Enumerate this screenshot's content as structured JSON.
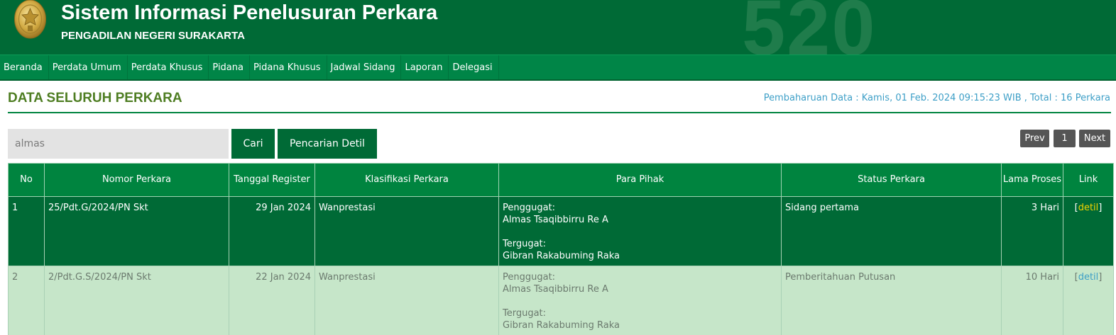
{
  "header": {
    "title": "Sistem Informasi Penelusuran Perkara",
    "subtitle": "PENGADILAN NEGERI SURAKARTA",
    "watermark": "520",
    "logo_icon": "court-emblem-icon"
  },
  "nav": {
    "items": [
      {
        "label": "Beranda"
      },
      {
        "label": "Perdata Umum"
      },
      {
        "label": "Perdata Khusus"
      },
      {
        "label": "Pidana"
      },
      {
        "label": "Pidana Khusus"
      },
      {
        "label": "Jadwal Sidang"
      },
      {
        "label": "Laporan"
      },
      {
        "label": "Delegasi"
      }
    ]
  },
  "page": {
    "title": "DATA SELURUH PERKARA",
    "update_info": "Pembaharuan Data : Kamis, 01 Feb. 2024 09:15:23 WIB , Total : 16 Perkara"
  },
  "search": {
    "value": "almas",
    "cari_label": "Cari",
    "detil_label": "Pencarian Detil"
  },
  "pagination": {
    "prev_label": "Prev",
    "current_page": "1",
    "next_label": "Next"
  },
  "table": {
    "headers": {
      "no": "No",
      "nomor": "Nomor Perkara",
      "tanggal": "Tanggal Register",
      "klasifikasi": "Klasifikasi Perkara",
      "pihak": "Para Pihak",
      "status": "Status Perkara",
      "lama": "Lama Proses",
      "link": "Link"
    },
    "rows": [
      {
        "no": "1",
        "nomor": "25/Pdt.G/2024/PN Skt",
        "tanggal": "29 Jan 2024",
        "klasifikasi": "Wanprestasi",
        "penggugat_label": "Penggugat:",
        "penggugat": "Almas Tsaqibbirru Re A",
        "tergugat_label": "Tergugat:",
        "tergugat": "Gibran Rakabuming Raka",
        "status": "Sidang pertama",
        "lama": "3 Hari",
        "link_open": "[",
        "link": "detil",
        "link_close": "]"
      },
      {
        "no": "2",
        "nomor": "2/Pdt.G.S/2024/PN Skt",
        "tanggal": "22 Jan 2024",
        "klasifikasi": "Wanprestasi",
        "penggugat_label": "Penggugat:",
        "penggugat": "Almas Tsaqibbirru Re A",
        "tergugat_label": "Tergugat:",
        "tergugat": "Gibran Rakabuming Raka",
        "status": "Pemberitahuan Putusan",
        "lama": "10 Hari",
        "link_open": "[",
        "link": "detil",
        "link_close": "]"
      }
    ]
  },
  "colors": {
    "header_bg": "#006a36",
    "nav_bg": "#008547",
    "table_header_bg": "#00843f",
    "row_dark_bg": "#006a36",
    "row_light_bg": "#c6e6c9",
    "title_color": "#4e7d22",
    "info_color": "#3d9fc7",
    "link_yellow": "#f2d200"
  }
}
